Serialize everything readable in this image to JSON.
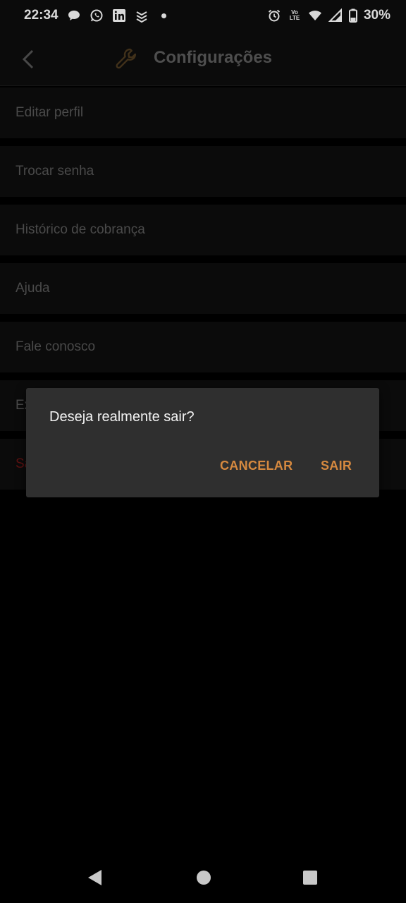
{
  "status_bar": {
    "time": "22:34",
    "notification_icons": [
      "chat-bubble-icon",
      "whatsapp-icon",
      "linkedin-icon",
      "app-icon"
    ],
    "status_icons": [
      "alarm-icon",
      "volte-icon",
      "wifi-icon",
      "signal-icon",
      "battery-icon"
    ],
    "volte_top": "Vo",
    "volte_bottom": "LTE",
    "battery": "30%"
  },
  "app_bar": {
    "title": "Configurações",
    "title_color": "#5c5c5c",
    "icon": "wrench-icon",
    "icon_color": "#4d3a1f"
  },
  "menu": {
    "items": [
      {
        "label": "Editar perfil"
      },
      {
        "label": "Trocar senha"
      },
      {
        "label": "Histórico de cobrança"
      },
      {
        "label": "Ajuda"
      },
      {
        "label": "Fale conosco"
      },
      {
        "label": "Ex"
      },
      {
        "label": "Sa"
      }
    ],
    "danger_color": "#6e1414"
  },
  "dialog": {
    "message": "Deseja realmente sair?",
    "cancel_label": "CANCELAR",
    "confirm_label": "SAIR",
    "accent_color": "#d6893f",
    "background": "#2f2f2f"
  },
  "nav_bar": {
    "buttons": [
      "back-triangle-icon",
      "home-circle-icon",
      "recents-square-icon"
    ]
  }
}
